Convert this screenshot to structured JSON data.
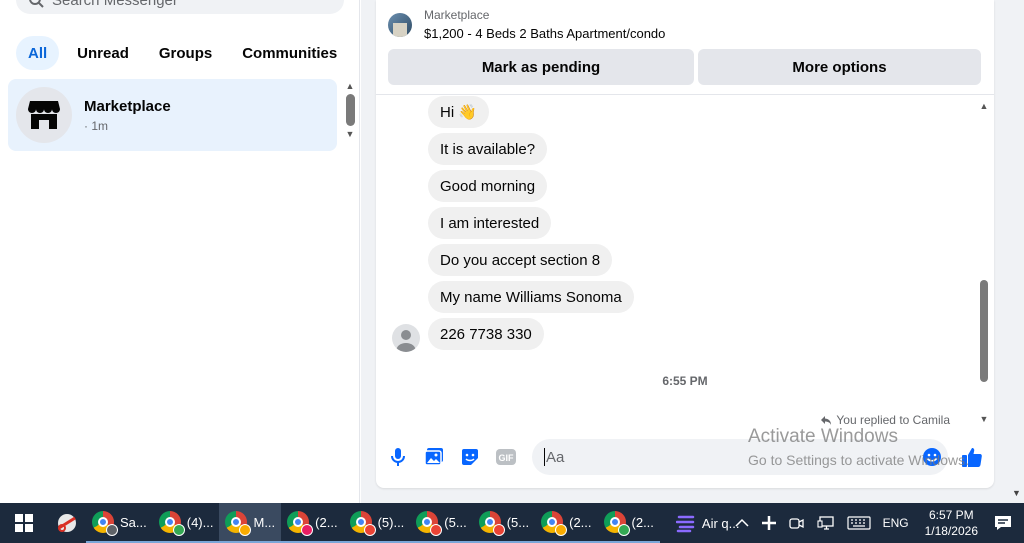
{
  "left": {
    "search_placeholder": "Search Messenger",
    "filters": [
      "All",
      "Unread",
      "Groups",
      "Communities"
    ],
    "active_filter": "All",
    "conversations": [
      {
        "name": "Marketplace",
        "time": "· 1m",
        "icon": "storefront-icon"
      }
    ]
  },
  "listing": {
    "category": "Marketplace",
    "title": "$1,200 - 4 Beds 2 Baths Apartment/condo",
    "mark_pending_label": "Mark as pending",
    "more_options_label": "More options"
  },
  "messages": [
    {
      "text": "Hi 👋"
    },
    {
      "text": "It is available?"
    },
    {
      "text": "Good morning"
    },
    {
      "text": "I am interested"
    },
    {
      "text": "Do you accept section 8"
    },
    {
      "text": "My name Williams Sonoma"
    },
    {
      "text": "226 7738 330"
    }
  ],
  "timestamp": "6:55 PM",
  "replied_note": "You replied to Camila",
  "composer": {
    "placeholder": "Aa",
    "icons": [
      "microphone-icon",
      "photo-icon",
      "sticker-icon",
      "gif-icon",
      "emoji-icon",
      "thumbs-up-icon"
    ]
  },
  "watermark": {
    "line1": "Activate Windows",
    "line2": "Go to Settings to activate Windows."
  },
  "taskbar": {
    "apps": [
      {
        "label": "Sa...",
        "badge_color": "#5f6368",
        "badge_text": "C"
      },
      {
        "label": "(4)...",
        "badge_color": "#34a853"
      },
      {
        "label": "M...",
        "badge_color": "#f9ab00",
        "active": true
      },
      {
        "label": "(2...",
        "badge_color": "#e91e63"
      },
      {
        "label": "(5)...",
        "badge_color": "#ea4335"
      },
      {
        "label": "(5...",
        "badge_color": "#ea4335"
      },
      {
        "label": "(5...",
        "badge_color": "#ea4335"
      },
      {
        "label": "(2...",
        "badge_color": "#f9ab00"
      },
      {
        "label": "(2...",
        "badge_color": "#34a853"
      }
    ],
    "air_quality": "Air q...",
    "language": "ENG",
    "time": "6:57 PM",
    "date": "1/18/2026"
  },
  "colors": {
    "accent": "#0866ff",
    "selected_bg": "#e8f2fd",
    "bubble_bg": "#f0f0f0",
    "taskbar_bg": "#1c2a3d"
  }
}
